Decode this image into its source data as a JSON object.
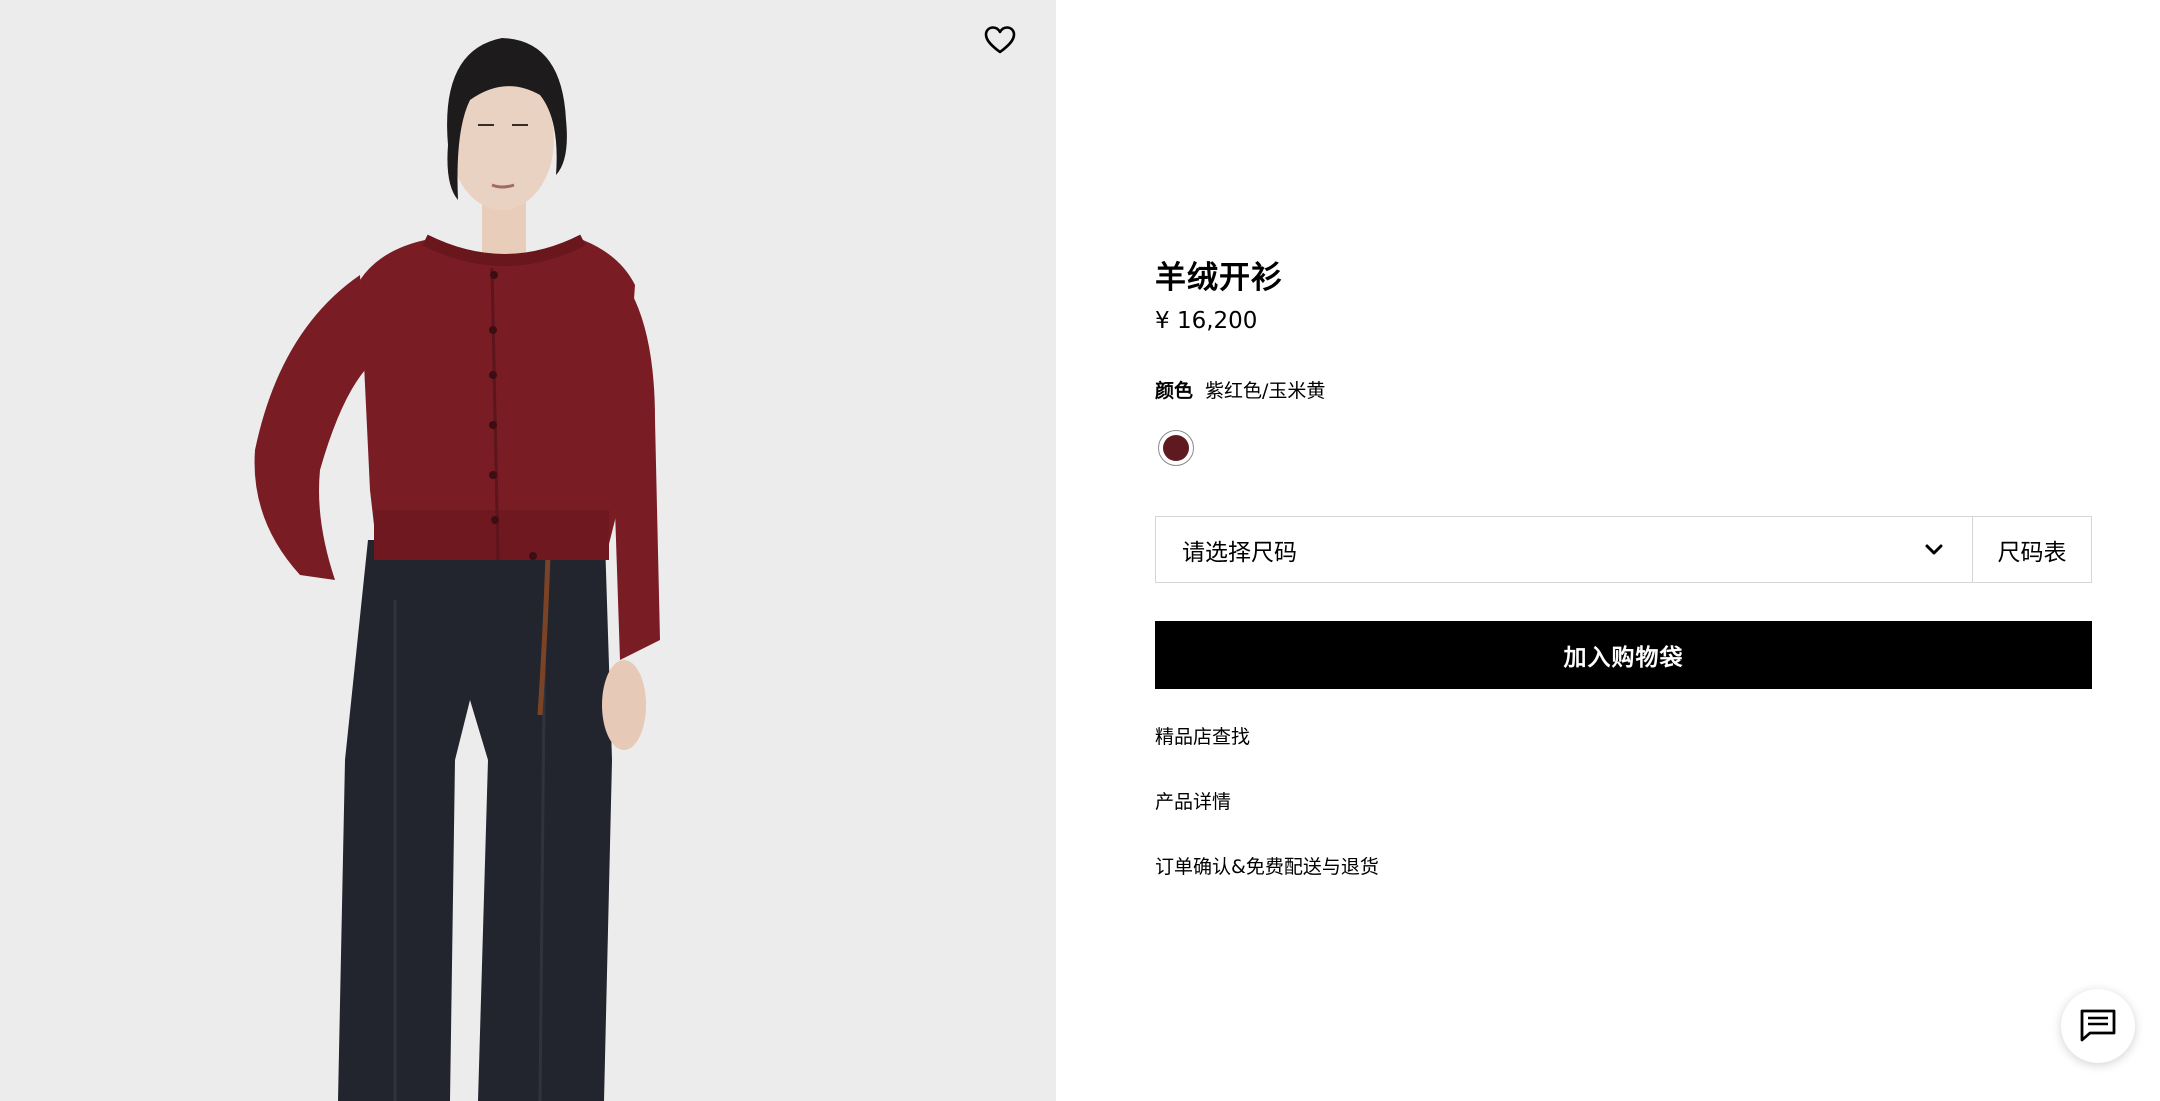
{
  "product": {
    "title": "羊绒开衫",
    "price": "¥ 16,200"
  },
  "color": {
    "label": "颜色",
    "value": "紫红色/玉米黄",
    "swatch_hex": "#5e1a1f"
  },
  "size": {
    "placeholder": "请选择尺码",
    "chart_label": "尺码表"
  },
  "actions": {
    "add_to_bag": "加入购物袋"
  },
  "links": [
    {
      "label": "精品店查找"
    },
    {
      "label": "产品详情"
    },
    {
      "label": "订单确认&免费配送与退货"
    }
  ],
  "icons": {
    "wishlist": "heart-icon",
    "size_dropdown": "chevron-down-icon",
    "chat": "chat-icon"
  },
  "colors": {
    "image_background": "#ececec",
    "cardigan": "#7a1c24",
    "trousers": "#22242e",
    "button_background": "#000000"
  }
}
